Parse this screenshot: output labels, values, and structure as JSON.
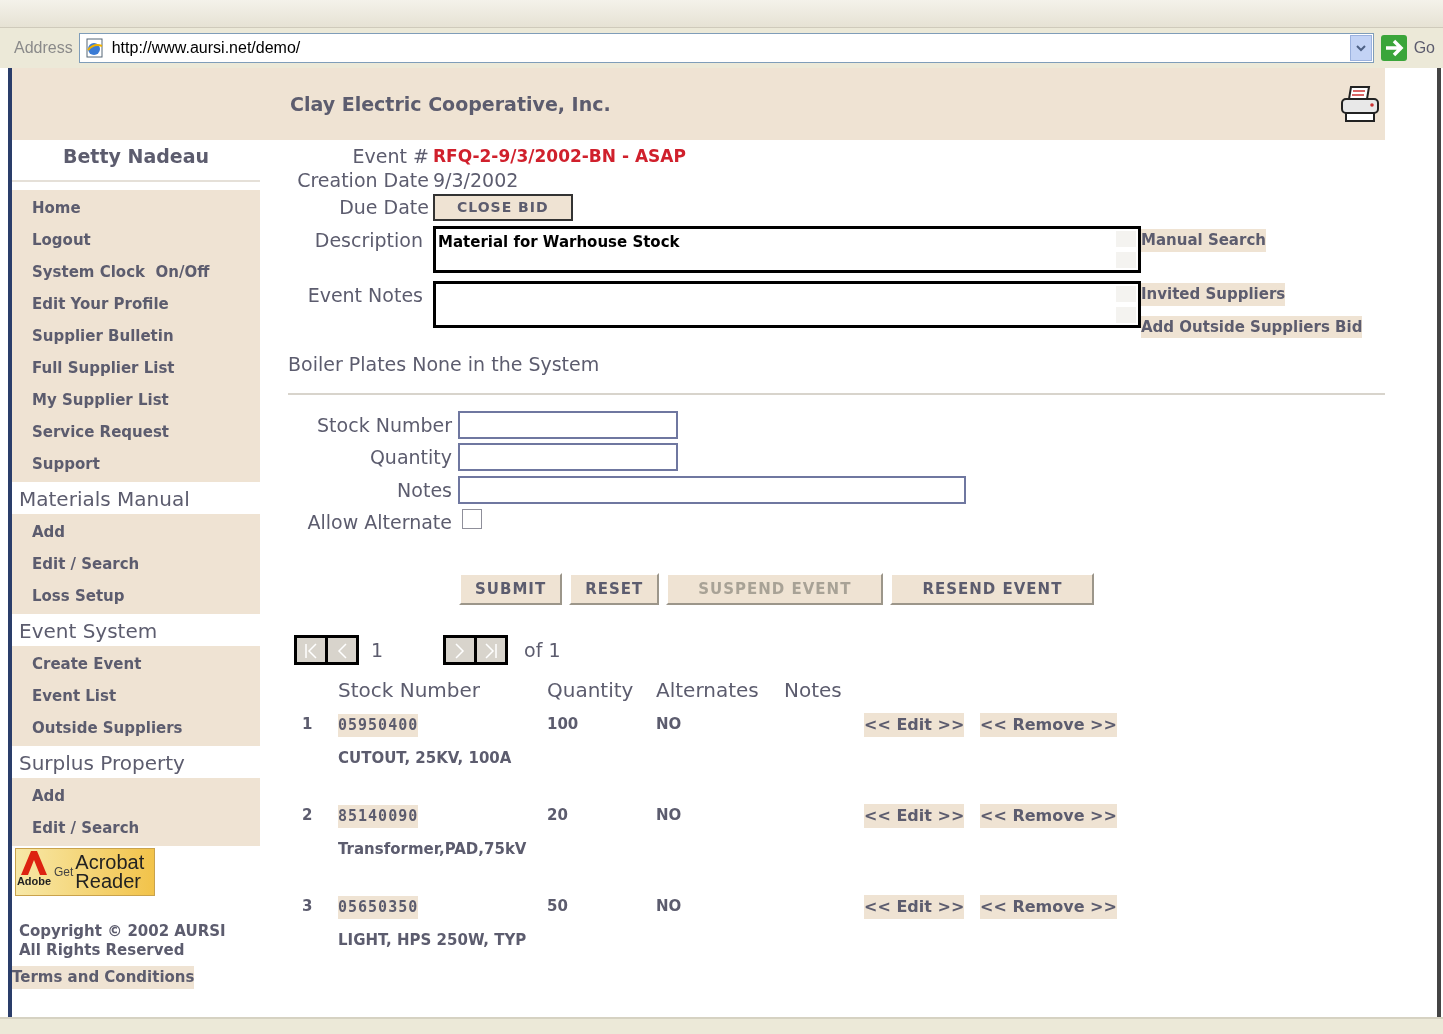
{
  "browser": {
    "address_label": "Address",
    "url": "http://www.aursi.net/demo/",
    "go_label": "Go"
  },
  "header": {
    "title": "Clay Electric Cooperative, Inc."
  },
  "sidebar": {
    "user": "Betty Nadeau",
    "groups": [
      {
        "items": [
          "Home",
          "Logout",
          "System Clock  On/Off",
          "Edit Your Profile",
          "Supplier Bulletin",
          "Full Supplier List",
          "My Supplier List",
          "Service Request",
          "Support"
        ]
      },
      {
        "heading": "Materials Manual",
        "items": [
          "Add",
          "Edit / Search",
          "Loss Setup"
        ]
      },
      {
        "heading": "Event System",
        "items": [
          "Create Event",
          "Event List",
          "Outside Suppliers"
        ]
      },
      {
        "heading": "Surplus Property",
        "items": [
          "Add",
          "Edit / Search"
        ]
      }
    ],
    "acrobat_badge": {
      "brand": "Adobe",
      "get": "Get",
      "product": "Acrobat",
      "reader": "Reader"
    },
    "copyright": [
      "Copyright © 2002 AURSI",
      "All Rights Reserved"
    ],
    "terms_link": "Terms and Conditions"
  },
  "event": {
    "event_label": "Event #",
    "event_value": "RFQ-2-9/3/2002-BN - ASAP",
    "creation_label": "Creation Date",
    "creation_value": "9/3/2002",
    "due_label": "Due Date",
    "close_bid_button": "CLOSE BID",
    "description_label": "Description",
    "description_value": "Material for Warhouse Stock",
    "notes_label": "Event Notes",
    "links": [
      "Manual Search",
      "Invited Suppliers",
      "Add Outside Suppliers Bid"
    ],
    "boiler_plates": "Boiler Plates None in the System"
  },
  "form": {
    "fields": [
      {
        "label": "Stock Number",
        "kind": "short"
      },
      {
        "label": "Quantity",
        "kind": "short"
      },
      {
        "label": "Notes",
        "kind": "long"
      }
    ],
    "allow_alternate": {
      "label": "Allow Alternate",
      "checked": false
    },
    "buttons": [
      {
        "label": "SUBMIT",
        "disabled": false
      },
      {
        "label": "RESET",
        "disabled": false
      },
      {
        "label": "SUSPEND EVENT",
        "disabled": true
      },
      {
        "label": "RESEND EVENT",
        "disabled": false
      }
    ]
  },
  "pager": {
    "page": "1",
    "of": "of 1"
  },
  "table": {
    "columns": [
      "Stock Number",
      "Quantity",
      "Alternates",
      "Notes"
    ],
    "rows": [
      {
        "index": "1",
        "stock": "05950400",
        "quantity": "100",
        "alternates": "NO",
        "description": "CUTOUT, 25KV, 100A",
        "edit": "<< Edit >>",
        "remove": "<< Remove >>"
      },
      {
        "index": "2",
        "stock": "85140090",
        "quantity": "20",
        "alternates": "NO",
        "description": "Transformer,PAD,75kV",
        "edit": "<< Edit >>",
        "remove": "<< Remove >>"
      },
      {
        "index": "3",
        "stock": "05650350",
        "quantity": "50",
        "alternates": "NO",
        "description": "LIGHT, HPS 250W, TYP",
        "edit": "<< Edit >>",
        "remove": "<< Remove >>"
      }
    ]
  }
}
